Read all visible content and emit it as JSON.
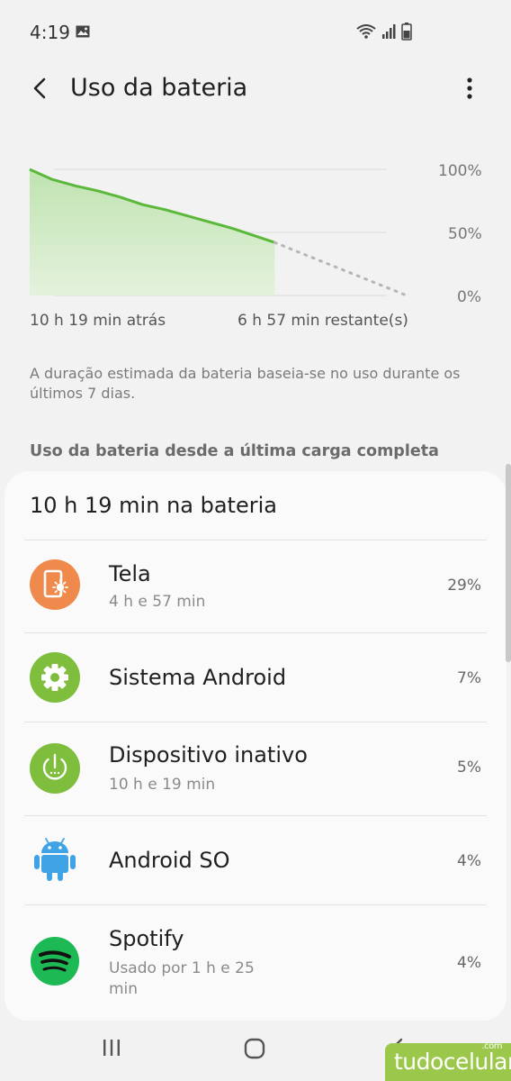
{
  "status_bar": {
    "time": "4:19"
  },
  "app_bar": {
    "title": "Uso da bateria"
  },
  "chart_data": {
    "type": "line",
    "yticks": [
      "100%",
      "50%",
      "0%"
    ],
    "ylim": [
      0,
      100
    ],
    "start_label": "10 h 19 min atrás",
    "end_label": "6 h 57 min restante(s)",
    "series": [
      {
        "x": [
          0,
          0.06,
          0.12,
          0.18,
          0.24,
          0.3,
          0.36,
          0.42,
          0.48,
          0.54,
          0.6,
          0.65
        ],
        "values": [
          100,
          92,
          87,
          83,
          78,
          72,
          68,
          63,
          58,
          53,
          47,
          42
        ]
      },
      {
        "x": [
          0.65,
          1.0
        ],
        "values": [
          42,
          0
        ]
      }
    ]
  },
  "note": "A duração estimada da bateria baseia-se no uso durante os últimos 7 dias.",
  "section_title": "Uso da bateria desde a última carga completa",
  "card": {
    "title": "10 h 19 min na bateria",
    "items": [
      {
        "name": "Tela",
        "sub": "4 h e 57 min",
        "pct": "29%",
        "icon": "screen-brightness-icon",
        "color": "#ef8a4c"
      },
      {
        "name": "Sistema Android",
        "sub": "",
        "pct": "7%",
        "icon": "settings-gear-icon",
        "color": "#7fbe3c"
      },
      {
        "name": "Dispositivo inativo",
        "sub": "10 h e 19 min",
        "pct": "5%",
        "icon": "power-idle-icon",
        "color": "#7fbe3c"
      },
      {
        "name": "Android SO",
        "sub": "",
        "pct": "4%",
        "icon": "android-robot-icon",
        "color": "#3fa3e5"
      },
      {
        "name": "Spotify",
        "sub": "Usado por 1 h e 25 min",
        "pct": "4%",
        "icon": "spotify-icon",
        "color": "#1db954"
      }
    ]
  },
  "watermark": {
    "text": "tudocelular",
    "domain": ".com"
  }
}
